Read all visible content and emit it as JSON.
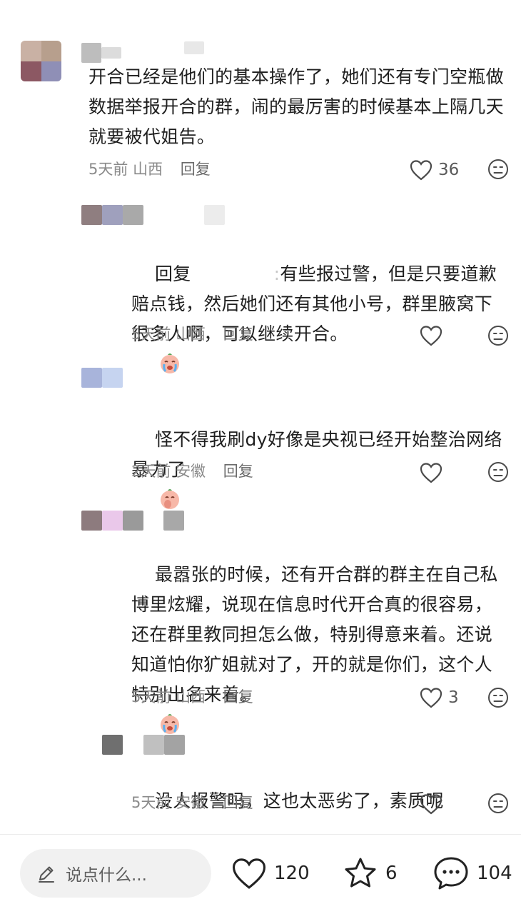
{
  "comments": [
    {
      "text": "开合已经是他们的基本操作了，她们还有专门空瓶做数据举报开合的群，闹的最厉害的时候基本上隔几天就要被代姐告。",
      "time": "5天前",
      "location": "山西",
      "reply_label": "回复",
      "likes": "36"
    },
    {
      "prefix": "回复",
      "text": "有些报过警，但是只要道歉赔点钱，然后她们还有其他小号，群里腋窝下很多人啊，可以继续开合。",
      "time": "5天前",
      "location": "山西",
      "reply_label": "回复",
      "likes": ""
    },
    {
      "text": "怪不得我刷dy好像是央视已经开始整治网络暴力了",
      "time": "2天前",
      "location": "安徽",
      "reply_label": "回复",
      "likes": ""
    },
    {
      "text": "最嚣张的时候，还有开合群的群主在自己私博里炫耀，说现在信息时代开合真的很容易，还在群里教同担怎么做，特别得意来着。还说知道怕你犷姐就对了，开的就是你们，这个人特别出名来着。",
      "time": "5天前",
      "location": "山西",
      "reply_label": "回复",
      "likes": "3"
    },
    {
      "text": "没人报警吗，这也太恶劣了，素质呢",
      "time": "5天前",
      "location": "安徽",
      "reply_label": "回复",
      "likes": ""
    }
  ],
  "bottom_bar": {
    "input_placeholder": "说点什么...",
    "likes": "120",
    "favorites": "6",
    "comments": "104"
  }
}
